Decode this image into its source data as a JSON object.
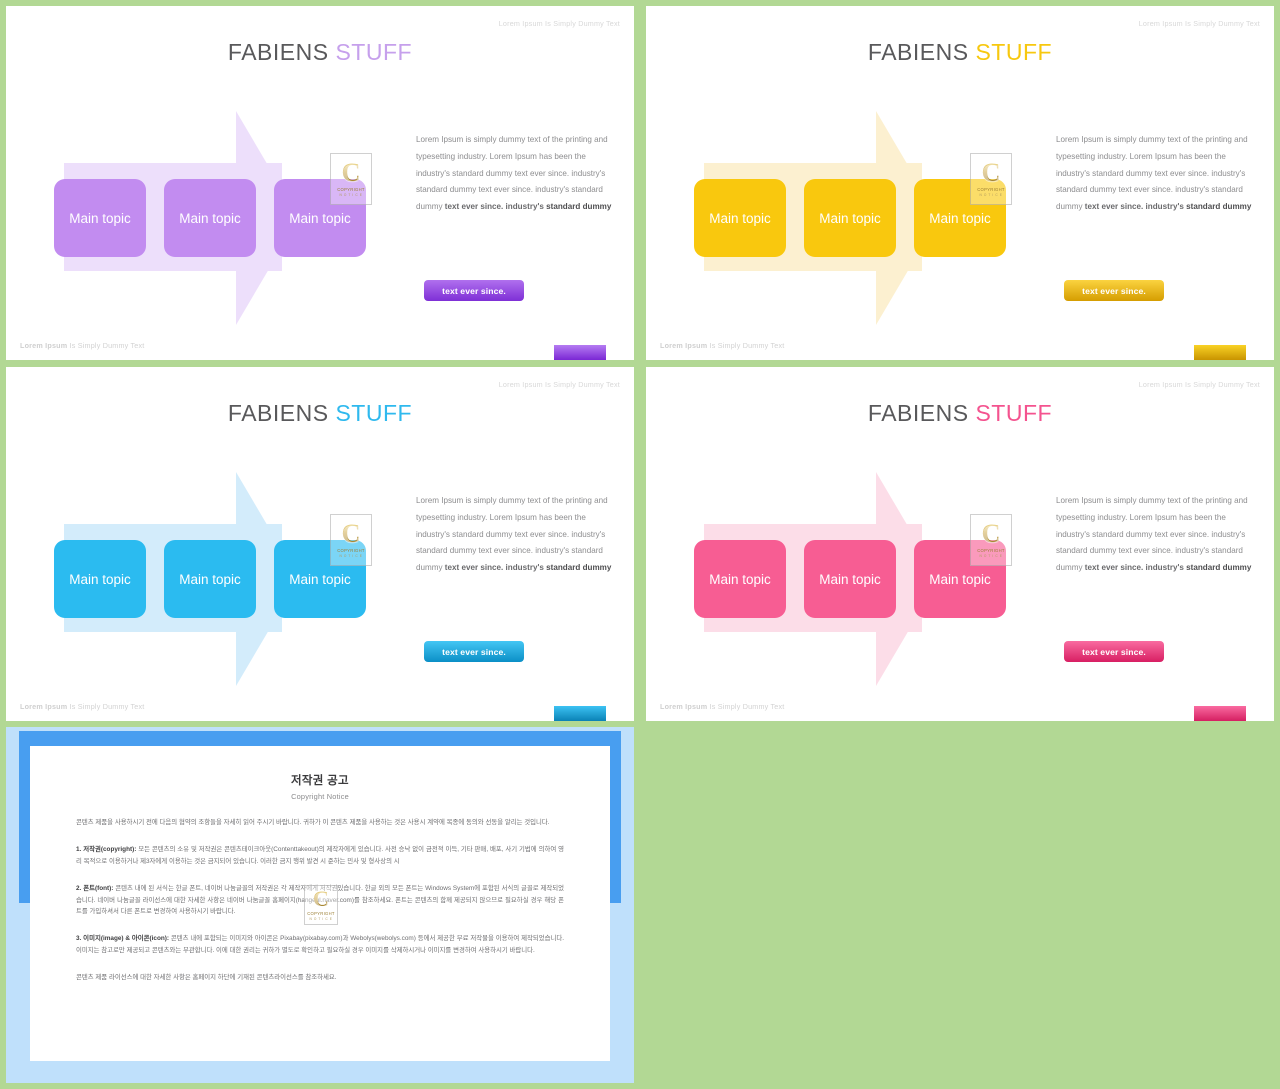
{
  "page": {
    "background_color": "#b2d894"
  },
  "shared": {
    "header_note": "Lorem Ipsum Is Simply Dummy Text",
    "footer_note_bold": "Lorem Ipsum",
    "footer_note_rest": " Is Simply Dummy Text",
    "title_primary": "FABIENS ",
    "title_accent": "STUFF",
    "box_label": "Main topic",
    "cta_label": "text ever since.",
    "paragraph_part1": "Lorem Ipsum is simply dummy text of the printing and typesetting industry.  Lorem Ipsum has been the industry's standard dummy text ever since. industry's standard dummy text ever since. industry's standard dummy ",
    "paragraph_strong": "text ever since. industry's ",
    "paragraph_strong2": "standard dummy",
    "watermark": {
      "letter": "C",
      "line1": "COPYRIGHT",
      "line2": "N O T I C E"
    }
  },
  "slides": [
    {
      "id": "slide-purple",
      "accent": "#b07ce8",
      "box_color": "#c28cf0",
      "arrow_color": "#eddffb",
      "cta_gradient_top": "#b070ee",
      "cta_gradient_bottom": "#7e2fd6",
      "footbar_top": "#b57cf2",
      "footbar_bottom": "#7a27d4",
      "title_accent_color": "#c6a0ec"
    },
    {
      "id": "slide-yellow",
      "accent": "#f6c312",
      "box_color": "#f9c80e",
      "arrow_color": "#fcf0d0",
      "cta_gradient_top": "#fbd340",
      "cta_gradient_bottom": "#d59d00",
      "footbar_top": "#f9d225",
      "footbar_bottom": "#c89400",
      "title_accent_color": "#f7c80f"
    },
    {
      "id": "slide-blue",
      "accent": "#29b8ef",
      "box_color": "#2bbbf0",
      "arrow_color": "#d3ecfb",
      "cta_gradient_top": "#44c6f4",
      "cta_gradient_bottom": "#0b8fc6",
      "footbar_top": "#3cc2f3",
      "footbar_bottom": "#0a82b6",
      "title_accent_color": "#2fb9ee"
    },
    {
      "id": "slide-pink",
      "accent": "#f4538f",
      "box_color": "#f75d93",
      "arrow_color": "#fcdde8",
      "cta_gradient_top": "#f96ba0",
      "cta_gradient_bottom": "#d81f63",
      "footbar_top": "#f96ba0",
      "footbar_bottom": "#d51f62",
      "title_accent_color": "#f4538f"
    }
  ],
  "document": {
    "title_ko": "저작권 공고",
    "title_en": "Copyright Notice",
    "intro": "콘텐츠 제품을 사용하시기 전에 다음의 협약의 조항들을 자세히 읽어 주시기 바랍니다. 귀하가 이 콘텐츠 제품을 사용하는 것은 사용시 계약에 복종에 동의와 선동을 알리는 것입니다.",
    "section1_label": "1. 저작권(copyright):",
    "section1_body": " 모든 콘텐츠의 소유 및 저작권은 콘텐츠테이크아웃(Contenttakeout)의 제작자에게 있습니다. 사전 승낙 없이 금전적 이득, 기타 판매, 배포, 사기 기법에 의하여 영리 목적으로 이용하거나 제3자에게 이용하는 것은 금지되어 있습니다. 이러한 금지 행위 발견 시 준하는 민사 및 형사상의 시",
    "section2_label": "2. 폰트(font):",
    "section2_body": " 콘텐츠 내에 된 서식는 한글 폰트, 네이버 나눔글꼴의 저작권은 각 제작자에게 저작권있습니다. 한글 외의 모든 폰트는 Windows System에 포함된 서식의 글꼴로 제작되었습니다. 네이버 나눔글꼴 라이선스에 대한 자세한 사항은 네이버 나눔글꼴 홈페이지(hangeul.naver.com)를 참조하세요. 폰트는 콘텐츠의 함께 제공되지 않으므로 필요하실 경우 해당 폰트를 가입하셔서 다른 폰트로 변경하여 사용하시기 바랍니다.",
    "section3_label": "3. 이미지(image) & 아이콘(icon):",
    "section3_body": " 콘텐츠 내에 포함되는 이미지와 아이콘은 Pixabay(pixabay.com)과 Webolys(webolys.com) 등에서 제공한 무료 저작물을 이용하여 제작되었습니다. 이미지는 참고로만 제공되고 콘텐츠와는 무관합니다. 이에 대한 권리는 귀하가 별도로 확인하고 필요하실 경우 이미지를 삭제하시거나 이미지를 변경하여 사용하시기 바랍니다.",
    "outro": "콘텐츠 제품 라이선스에 대한 자세한 사항은 홈페이지 하단에 기재된 콘텐츠라이선스를 참조하세요."
  }
}
